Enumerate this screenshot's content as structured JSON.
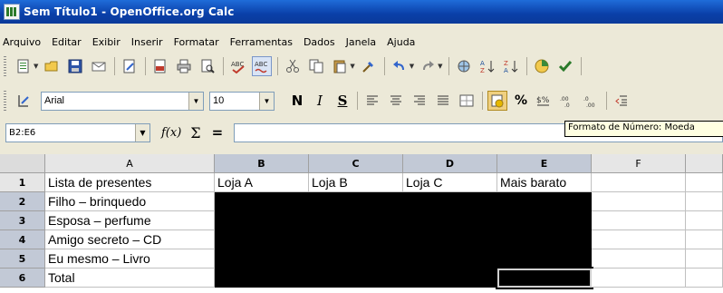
{
  "window": {
    "title": "Sem Título1 - OpenOffice.org Calc"
  },
  "menu": [
    {
      "label": "Arquivo"
    },
    {
      "label": "Editar"
    },
    {
      "label": "Exibir"
    },
    {
      "label": "Inserir"
    },
    {
      "label": "Formatar"
    },
    {
      "label": "Ferramentas"
    },
    {
      "label": "Dados"
    },
    {
      "label": "Janela"
    },
    {
      "label": "Ajuda"
    }
  ],
  "toolbar_icons": [
    "new-icon",
    "open-icon",
    "save-icon",
    "email-icon",
    "edit-file-icon",
    "export-pdf-icon",
    "print-icon",
    "page-preview-icon",
    "spellcheck-icon",
    "autospellcheck-icon",
    "cut-icon",
    "copy-icon",
    "paste-icon",
    "format-paintbrush-icon",
    "undo-icon",
    "redo-icon",
    "hyperlink-icon",
    "sort-ascending-icon",
    "sort-descending-icon",
    "chart-icon",
    "check-icon"
  ],
  "format": {
    "font_name": "Arial",
    "font_size": "10",
    "bold_label": "N",
    "italic_label": "I",
    "underline_label": "S",
    "percent_label": "%",
    "tooltip": "Formato de Número: Moeda"
  },
  "formula": {
    "name_box": "B2:E6",
    "fx_label": "f(x)",
    "sum_label": "Σ",
    "equals_label": "=",
    "value": ""
  },
  "sheet": {
    "columns": [
      "A",
      "B",
      "C",
      "D",
      "E",
      "F"
    ],
    "selected_columns": [
      "B",
      "C",
      "D",
      "E"
    ],
    "rows": [
      {
        "num": "1",
        "cells": [
          "Lista de presentes",
          "Loja A",
          "Loja B",
          "Loja C",
          "Mais barato",
          ""
        ]
      },
      {
        "num": "2",
        "cells": [
          "Filho – brinquedo",
          "",
          "",
          "",
          "",
          ""
        ]
      },
      {
        "num": "3",
        "cells": [
          "Esposa – perfume",
          "",
          "",
          "",
          "",
          ""
        ]
      },
      {
        "num": "4",
        "cells": [
          "Amigo secreto – CD",
          "",
          "",
          "",
          "",
          ""
        ]
      },
      {
        "num": "5",
        "cells": [
          "Eu mesmo – Livro",
          "",
          "",
          "",
          "",
          ""
        ]
      },
      {
        "num": "6",
        "cells": [
          "Total",
          "",
          "",
          "",
          "",
          ""
        ]
      }
    ],
    "selected_rows": [
      "2",
      "3",
      "4",
      "5",
      "6"
    ]
  }
}
